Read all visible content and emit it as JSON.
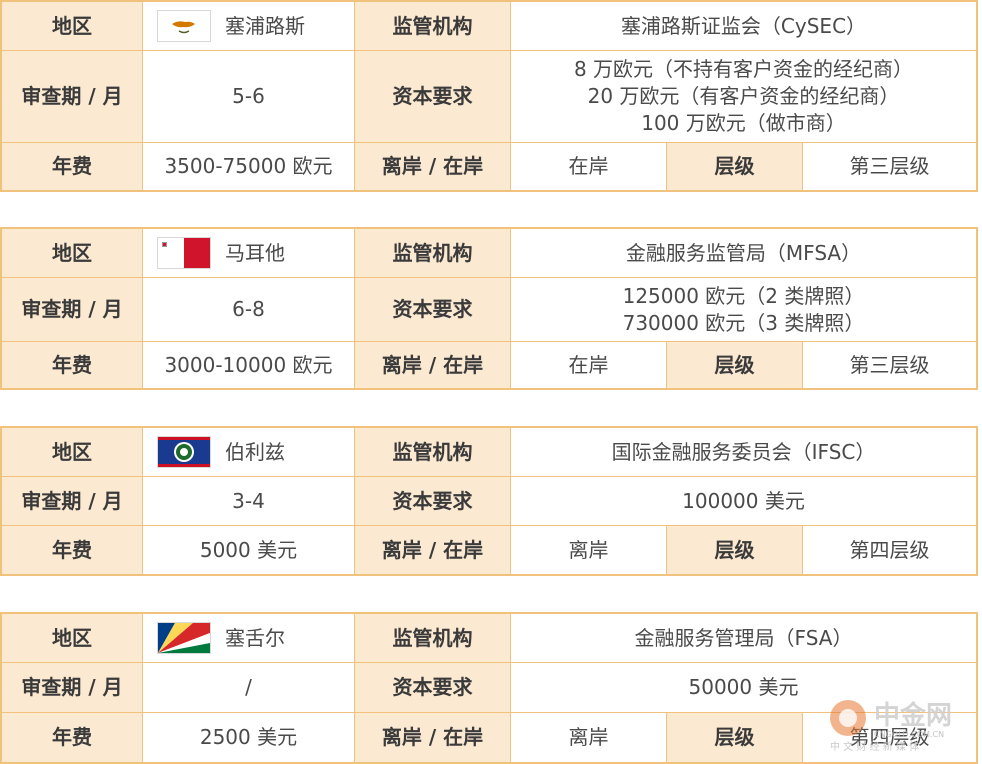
{
  "labels": {
    "region": "地区",
    "regulator": "监管机构",
    "review_period": "审查期 / 月",
    "capital": "资本要求",
    "annual_fee": "年费",
    "offshore_onshore": "离岸 / 在岸",
    "tier": "层级"
  },
  "jurisdictions": [
    {
      "region": "塞浦路斯",
      "flag_icon": "cyprus-flag-icon",
      "regulator": "塞浦路斯证监会（CySEC）",
      "review_period": "5-6",
      "capital": [
        "8 万欧元（不持有客户资金的经纪商）",
        "20 万欧元（有客户资金的经纪商）",
        "100 万欧元（做市商）"
      ],
      "annual_fee": "3500-75000 欧元",
      "offshore_onshore": "在岸",
      "tier": "第三层级"
    },
    {
      "region": "马耳他",
      "flag_icon": "malta-flag-icon",
      "regulator": "金融服务监管局（MFSA）",
      "review_period": "6-8",
      "capital": [
        "125000 欧元（2 类牌照）",
        "730000 欧元（3 类牌照）"
      ],
      "annual_fee": "3000-10000 欧元",
      "offshore_onshore": "在岸",
      "tier": "第三层级"
    },
    {
      "region": "伯利兹",
      "flag_icon": "belize-flag-icon",
      "regulator": "国际金融服务委员会（IFSC）",
      "review_period": "3-4",
      "capital": [
        "100000 美元"
      ],
      "annual_fee": "5000 美元",
      "offshore_onshore": "离岸",
      "tier": "第四层级"
    },
    {
      "region": "塞舌尔",
      "flag_icon": "seychelles-flag-icon",
      "regulator": "金融服务管理局（FSA）",
      "review_period": "/",
      "capital": [
        "50000 美元"
      ],
      "annual_fee": "2500 美元",
      "offshore_onshore": "离岸",
      "tier": "第四层级"
    }
  ],
  "watermark": {
    "name": "中金网",
    "domain": "CNGOLD.COM.CN",
    "slogan": "中 文 财 经 新 媒 体",
    "icon": "cngold-logo-icon",
    "color": "#e8772e"
  },
  "colors": {
    "border": "#f0c27b",
    "header_bg": "#fbe9d2"
  }
}
